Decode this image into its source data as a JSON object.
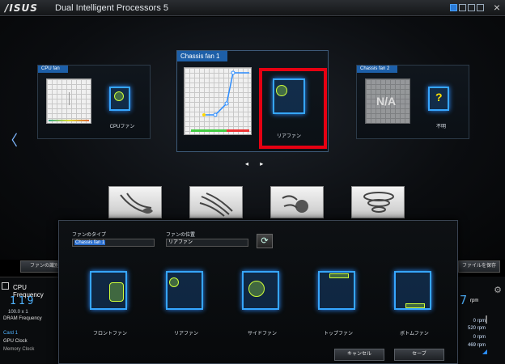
{
  "window": {
    "logo": "/ISUS",
    "title": "Dual Intelligent Processors 5",
    "close": "×"
  },
  "cards": [
    {
      "header": "CPU fan",
      "label": "CPUファン"
    },
    {
      "header": "Chassis fan 1",
      "label": "リアファン"
    },
    {
      "header": "Chassis fan 2",
      "label": "不明",
      "na": "N/A",
      "unknown_mark": "?"
    }
  ],
  "pager": "◂ ▸",
  "nav_left_arrow": "〈",
  "bottom": {
    "left_button": "ファンの識別",
    "right_button": "ファイルを保存"
  },
  "cpu_panel": {
    "title": "CPU Frequency",
    "big_value": "119",
    "sub": "100.0 x 1",
    "dram": "DRAM Frequency",
    "card": "Card 1",
    "gpu": "GPU Clock",
    "mem": "Memory Clock"
  },
  "rpm_panel": {
    "big_value": "7",
    "unit": "rpm",
    "rows": [
      "0 rpm",
      "520 rpm",
      "0 rpm",
      "469 rpm"
    ]
  },
  "dialog": {
    "type_label": "ファンのタイプ",
    "type_value": "Chassis fan 1",
    "position_label": "ファンの位置",
    "position_value": "リアファン",
    "positions": [
      "フロントファン",
      "リアファン",
      "サイドファン",
      "トップファン",
      "ボトムファン"
    ],
    "cancel": "キャンセル",
    "save": "セーブ"
  },
  "colors": {
    "accent": "#2a8cff",
    "highlight": "#e60012",
    "header": "#1d5fa8"
  }
}
